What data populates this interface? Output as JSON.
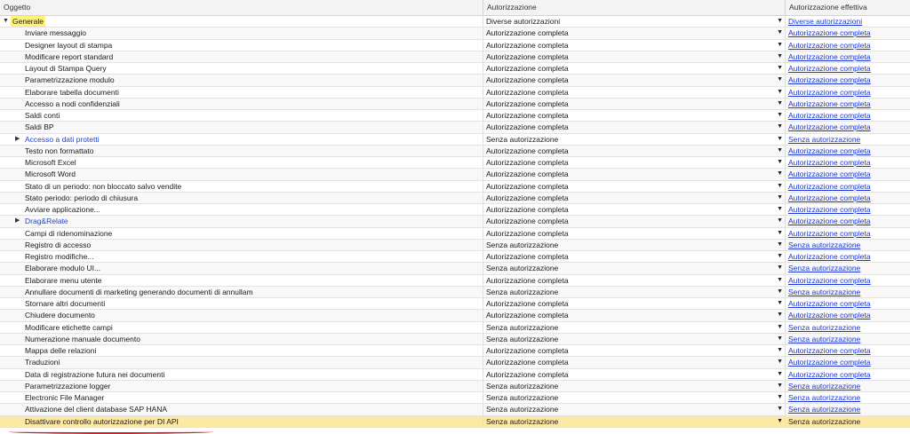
{
  "columns": {
    "object": "Oggetto",
    "authorization": "Autorizzazione",
    "effective": "Autorizzazione effettiva"
  },
  "rows": [
    {
      "label": "Generale",
      "level": 0,
      "expand": "down",
      "highlight": true,
      "auth": "Diverse autorizzazioni",
      "eff": "Diverse autorizzazioni"
    },
    {
      "label": "Inviare messaggio",
      "level": 1,
      "auth": "Autorizzazione completa",
      "eff": "Autorizzazione completa"
    },
    {
      "label": "Designer layout di stampa",
      "level": 1,
      "auth": "Autorizzazione completa",
      "eff": "Autorizzazione completa"
    },
    {
      "label": "Modificare report standard",
      "level": 1,
      "auth": "Autorizzazione completa",
      "eff": "Autorizzazione completa"
    },
    {
      "label": "Layout di Stampa Query",
      "level": 1,
      "auth": "Autorizzazione completa",
      "eff": "Autorizzazione completa"
    },
    {
      "label": "Parametrizzazione modulo",
      "level": 1,
      "auth": "Autorizzazione completa",
      "eff": "Autorizzazione completa"
    },
    {
      "label": "Elaborare tabella documenti",
      "level": 1,
      "auth": "Autorizzazione completa",
      "eff": "Autorizzazione completa"
    },
    {
      "label": "Accesso a nodi confidenziali",
      "level": 1,
      "auth": "Autorizzazione completa",
      "eff": "Autorizzazione completa"
    },
    {
      "label": "Saldi conti",
      "level": 1,
      "auth": "Autorizzazione completa",
      "eff": "Autorizzazione completa"
    },
    {
      "label": "Saldi BP",
      "level": 1,
      "auth": "Autorizzazione completa",
      "eff": "Autorizzazione completa"
    },
    {
      "label": "Accesso a dati protetti",
      "level": 1,
      "expand": "right",
      "link": true,
      "auth": "Senza autorizzazione",
      "eff": "Senza autorizzazione"
    },
    {
      "label": "Testo non formattato",
      "level": 1,
      "auth": "Autorizzazione completa",
      "eff": "Autorizzazione completa"
    },
    {
      "label": "Microsoft Excel",
      "level": 1,
      "auth": "Autorizzazione completa",
      "eff": "Autorizzazione completa"
    },
    {
      "label": "Microsoft Word",
      "level": 1,
      "auth": "Autorizzazione completa",
      "eff": "Autorizzazione completa"
    },
    {
      "label": "Stato di un periodo: non bloccato salvo vendite",
      "level": 1,
      "auth": "Autorizzazione completa",
      "eff": "Autorizzazione completa"
    },
    {
      "label": "Stato periodo: periodo di chiusura",
      "level": 1,
      "auth": "Autorizzazione completa",
      "eff": "Autorizzazione completa"
    },
    {
      "label": "Avviare applicazione...",
      "level": 1,
      "auth": "Autorizzazione completa",
      "eff": "Autorizzazione completa"
    },
    {
      "label": "Drag&Relate",
      "level": 1,
      "expand": "right",
      "link": true,
      "auth": "Autorizzazione completa",
      "eff": "Autorizzazione completa"
    },
    {
      "label": "Campi di ridenominazione",
      "level": 1,
      "auth": "Autorizzazione completa",
      "eff": "Autorizzazione completa"
    },
    {
      "label": "Registro di accesso",
      "level": 1,
      "auth": "Senza autorizzazione",
      "eff": "Senza autorizzazione"
    },
    {
      "label": "Registro modifiche...",
      "level": 1,
      "auth": "Autorizzazione completa",
      "eff": "Autorizzazione completa"
    },
    {
      "label": "Elaborare modulo UI...",
      "level": 1,
      "auth": "Senza autorizzazione",
      "eff": "Senza autorizzazione"
    },
    {
      "label": "Elaborare menu utente",
      "level": 1,
      "auth": "Autorizzazione completa",
      "eff": "Autorizzazione completa"
    },
    {
      "label": "Annullare documenti di marketing generando documenti di annullam",
      "level": 1,
      "auth": "Senza autorizzazione",
      "eff": "Senza autorizzazione"
    },
    {
      "label": "Stornare altri documenti",
      "level": 1,
      "auth": "Autorizzazione completa",
      "eff": "Autorizzazione completa"
    },
    {
      "label": "Chiudere documento",
      "level": 1,
      "auth": "Autorizzazione completa",
      "eff": "Autorizzazione completa"
    },
    {
      "label": "Modificare etichette campi",
      "level": 1,
      "auth": "Senza autorizzazione",
      "eff": "Senza autorizzazione"
    },
    {
      "label": "Numerazione manuale documento",
      "level": 1,
      "auth": "Senza autorizzazione",
      "eff": "Senza autorizzazione"
    },
    {
      "label": "Mappa delle relazioni",
      "level": 1,
      "auth": "Autorizzazione completa",
      "eff": "Autorizzazione completa"
    },
    {
      "label": "Traduzioni",
      "level": 1,
      "auth": "Autorizzazione completa",
      "eff": "Autorizzazione completa"
    },
    {
      "label": "Data di registrazione futura nei documenti",
      "level": 1,
      "auth": "Autorizzazione completa",
      "eff": "Autorizzazione completa"
    },
    {
      "label": "Parametrizzazione logger",
      "level": 1,
      "auth": "Senza autorizzazione",
      "eff": "Senza autorizzazione"
    },
    {
      "label": "Electronic File Manager",
      "level": 1,
      "auth": "Senza autorizzazione",
      "eff": "Senza autorizzazione"
    },
    {
      "label": "Attivazione del client database SAP HANA",
      "level": 1,
      "auth": "Senza autorizzazione",
      "eff": "Senza autorizzazione"
    },
    {
      "label": "Disattivare controllo autorizzazione per DI API",
      "level": 1,
      "selected": true,
      "auth": "Senza autorizzazione",
      "eff": "Senza autorizzazione"
    }
  ],
  "colors": {
    "highlight": "#fff27a",
    "selected_row": "#fde9a4",
    "link": "#1a35d8",
    "annotation": "#e11b1b"
  }
}
